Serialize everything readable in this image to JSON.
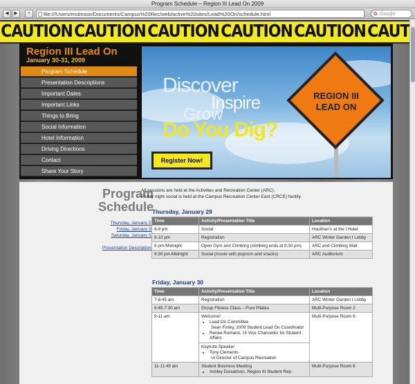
{
  "window": {
    "title": "Program Schedule – Region III Lead On 2009",
    "url": "file:///Users/mstinson/Documents/Campus%20Rec/web/active%20sites/Lead%20On/schedule.html",
    "search_placeholder": "Google",
    "back_glyph": "◀",
    "forward_glyph": "▶",
    "plus_glyph": "+"
  },
  "caution": {
    "text": "CAUTION"
  },
  "header": {
    "title": "Region III Lead On",
    "dates": "January 30-31, 2009"
  },
  "nav": {
    "items": [
      {
        "label": "Program Schedule"
      },
      {
        "label": "Presentation Descriptions"
      },
      {
        "label": "Important Dates"
      },
      {
        "label": "Important Links"
      },
      {
        "label": "Things to Bring"
      },
      {
        "label": "Social Information"
      },
      {
        "label": "Hotel Information"
      },
      {
        "label": "Driving Directions"
      },
      {
        "label": "Contact"
      },
      {
        "label": "Share Your Story"
      }
    ],
    "active_index": 0
  },
  "hero": {
    "discover": "Discover",
    "inspire": "Inspire",
    "grow": "Grow",
    "dig": "Do You Dig?",
    "sign_line1": "REGION III",
    "sign_line2": "LEAD ON",
    "register_label": "Register Now!"
  },
  "content": {
    "heading_line1": "Program",
    "heading_line2": "Schedule",
    "links": {
      "thu": "Thursday, January 29",
      "fri": "Friday, January 30",
      "sat": "Saturday, January 31",
      "presentations": "Presentation Descriptions"
    },
    "intro1": "All sessions are held at the Activities and Recreation Center (ARC).",
    "intro2": "Friday night social is held at the Campus Recreation Center East (CRCE) facility.",
    "columns": {
      "time": "Time",
      "activity": "Activity/Presentation Title",
      "location": "Location"
    },
    "thursday": {
      "title": "Thursday, January 29",
      "rows": [
        {
          "time": "6-9 pm",
          "activity": "Social",
          "location": "Houlihan's at the I Hotel"
        },
        {
          "time": "6-10 pm",
          "activity": "Registration",
          "location": "ARC Winter Garden I Lobby"
        },
        {
          "time": "6 pm-Midnight",
          "activity": "Open Gym and Climbing (climbing ends at 9:30 pm)",
          "location": "ARC and Climbing Wall"
        },
        {
          "time": "9:30 pm-Midnight",
          "activity": "Social (movie with popcorn and snacks)",
          "location": "ARC Auditorium"
        }
      ]
    },
    "friday": {
      "title": "Friday, January 30",
      "rows": [
        {
          "time": "7-8:45 am",
          "activity": "Registration",
          "location": "ARC Winter Garden I Lobby"
        },
        {
          "time": "6:45-7:30 am",
          "activity": "Group Fitness Class – Pure Pilates",
          "location": "Multi-Purpose Room 2"
        },
        {
          "time": "9-11 am",
          "activity": "Welcome!",
          "location": "Multi-Purpose Room 6"
        },
        {
          "time": "11-11:45 am",
          "activity": "Student Business Meeting",
          "location": "Multi-Purpose Room 6"
        }
      ],
      "welcome_bullets": [
        "Lead On Committee",
        "Sean Finley, 2009 Student Lead On Coordinator",
        "Renee Romano, UI Vice Chancellor for Student Affairs"
      ],
      "keynote_label": "Keynote Speaker",
      "keynote_bullets": [
        "Tony Clements",
        "UI Director of Campus Recreation"
      ],
      "business_bullets": [
        "Ashley Donaldson, Region III Student Rep."
      ]
    }
  }
}
